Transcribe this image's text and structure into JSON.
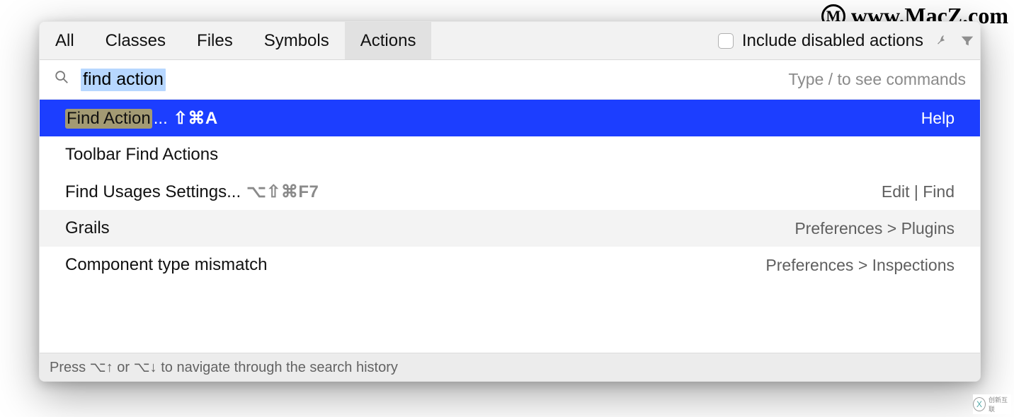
{
  "tabs": {
    "items": [
      "All",
      "Classes",
      "Files",
      "Symbols",
      "Actions"
    ],
    "selected_index": 4
  },
  "toolbar": {
    "include_disabled_label": "Include disabled actions",
    "include_disabled_checked": false
  },
  "search": {
    "query": "find action",
    "hint": "Type / to see commands"
  },
  "results": [
    {
      "highlight": "Find Action",
      "suffix": "...",
      "shortcut": "⇧⌘A",
      "context": "Help",
      "selected": true
    },
    {
      "label": "Toolbar Find Actions",
      "context": ""
    },
    {
      "label": "Find Usages Settings...",
      "shortcut": "⌥⇧⌘F7",
      "shortcut_dim": true,
      "context": "Edit | Find"
    },
    {
      "label": "Grails",
      "context": "Preferences > Plugins",
      "odd": true
    },
    {
      "label": "Component type mismatch",
      "context": "Preferences > Inspections"
    }
  ],
  "footer": {
    "text": "Press ⌥↑ or ⌥↓ to navigate through the search history"
  },
  "watermark": {
    "text": "www.MacZ.com"
  },
  "corner_badge": {
    "text": "创新互联"
  }
}
